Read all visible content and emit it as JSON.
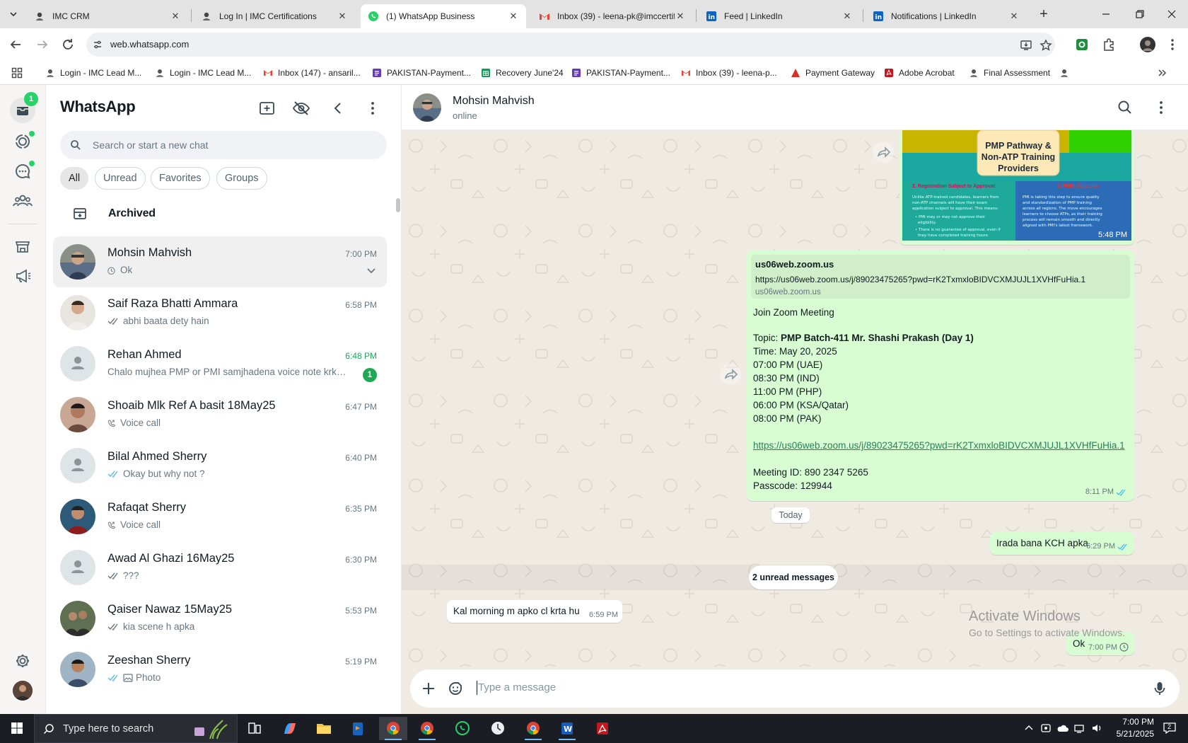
{
  "browser": {
    "tabs": [
      {
        "title": "IMC CRM",
        "active": false
      },
      {
        "title": "Log In | IMC Certifications",
        "active": false
      },
      {
        "title": "(1) WhatsApp Business",
        "active": true
      },
      {
        "title": "Inbox (39) - leena-pk@imccertif",
        "active": false
      },
      {
        "title": "Feed | LinkedIn",
        "active": false
      },
      {
        "title": "Notifications | LinkedIn",
        "active": false
      }
    ],
    "url": "web.whatsapp.com",
    "bookmarks": [
      {
        "label": "Login - IMC Lead M...",
        "icon": "imc-icon"
      },
      {
        "label": "Login - IMC Lead M...",
        "icon": "imc-icon"
      },
      {
        "label": "Inbox (147) - ansaril...",
        "icon": "gmail-icon"
      },
      {
        "label": "PAKISTAN-Payment...",
        "icon": "forms-icon"
      },
      {
        "label": "Recovery June'24",
        "icon": "sheets-icon"
      },
      {
        "label": "PAKISTAN-Payment...",
        "icon": "forms-icon"
      },
      {
        "label": "Inbox (39) - leena-p...",
        "icon": "gmail-icon"
      },
      {
        "label": "Payment Gateway",
        "icon": "gateway-icon"
      },
      {
        "label": "Adobe Acrobat",
        "icon": "acrobat-icon"
      },
      {
        "label": "Final Assessment",
        "icon": "imc-icon"
      }
    ]
  },
  "rail": {
    "chats_badge": "1"
  },
  "chatlist": {
    "title": "WhatsApp",
    "search_placeholder": "Search or start a new chat",
    "filters": [
      "All",
      "Unread",
      "Favorites",
      "Groups"
    ],
    "archived_label": "Archived",
    "chats": [
      {
        "name": "Mohsin Mahvish",
        "time": "7:00 PM",
        "preview": "Ok",
        "status": "clock",
        "selected": true
      },
      {
        "name": "Saif Raza Bhatti Ammara",
        "time": "6:58 PM",
        "preview": "abhi baata dety hain",
        "status": "double-grey"
      },
      {
        "name": "Rehan Ahmed",
        "time": "6:48 PM",
        "preview": "Chalo mujhea PMP or PMI samjhadena voice note krke ...",
        "status": "none",
        "unread": "1"
      },
      {
        "name": "Shoaib Mlk Ref A basit 18May25",
        "time": "6:47 PM",
        "preview": "Voice call",
        "status": "call"
      },
      {
        "name": "Bilal Ahmed Sherry",
        "time": "6:40 PM",
        "preview": "Okay but why not ?",
        "status": "double-blue"
      },
      {
        "name": "Rafaqat Sherry",
        "time": "6:35 PM",
        "preview": "Voice call",
        "status": "call"
      },
      {
        "name": "Awad Al Ghazi 16May25",
        "time": "6:30 PM",
        "preview": "???",
        "status": "double-grey"
      },
      {
        "name": "Qaiser Nawaz 15May25",
        "time": "5:53 PM",
        "preview": "kia scene h apka",
        "status": "double-grey"
      },
      {
        "name": "Zeeshan Sherry",
        "time": "5:19 PM",
        "preview": "Photo",
        "status": "double-blue-photo"
      }
    ]
  },
  "conversation": {
    "contact_name": "Mohsin Mahvish",
    "contact_status": "online",
    "image_card": {
      "heading_line1": "PMP Pathway &",
      "heading_line2": "Non-ATP Training",
      "heading_line3": "Providers",
      "left_title": "2. Registration Subject to Approval:",
      "right_title": "3. PMI's Objective:",
      "time": "5:48 PM"
    },
    "zoom_message": {
      "preview_title": "us06web.zoom.us",
      "preview_url": "https://us06web.zoom.us/j/89023475265?pwd=rK2TxmxloBIDVCXMJUJL1XVHfFuHia.1",
      "preview_domain": "us06web.zoom.us",
      "line_join": "Join Zoom Meeting",
      "topic_label": "Topic: ",
      "topic_value": "PMP Batch-411 Mr. Shashi Prakash (Day 1)",
      "time_line": "Time: May 20, 2025",
      "schedule": [
        "07:00 PM (UAE)",
        "08:30 PM (IND)",
        "11:00 PM (PHP)",
        "06:00 PM (KSA/Qatar)",
        "08:00 PM (PAK)"
      ],
      "link": "https://us06web.zoom.us/j/89023475265?pwd=rK2TxmxloBIDVCXMJUJL1XVHfFuHia.1",
      "meeting_id": "Meeting ID: 890 2347 5265",
      "passcode": "Passcode: 129944",
      "time": "8:11 PM"
    },
    "today_label": "Today",
    "out_message_1": {
      "text": "Irada bana KCH apka",
      "time": "6:29 PM"
    },
    "unread_label": "2 unread messages",
    "in_message_1": {
      "text": "Kal morning m apko cl krta hu",
      "time": "6:59 PM"
    },
    "out_message_2": {
      "text": "Ok",
      "time": "7:00 PM"
    },
    "composer_placeholder": "Type a message",
    "watermark_title": "Activate Windows",
    "watermark_sub": "Go to Settings to activate Windows."
  },
  "taskbar": {
    "search_placeholder": "Type here to search",
    "time": "7:00 PM",
    "date": "5/21/2025",
    "notification_count": "2"
  },
  "colors": {
    "wa_green": "#25d366",
    "bubble_out": "#d9fdd3",
    "tick_blue": "#53bdeb",
    "link_green": "#25805e"
  }
}
